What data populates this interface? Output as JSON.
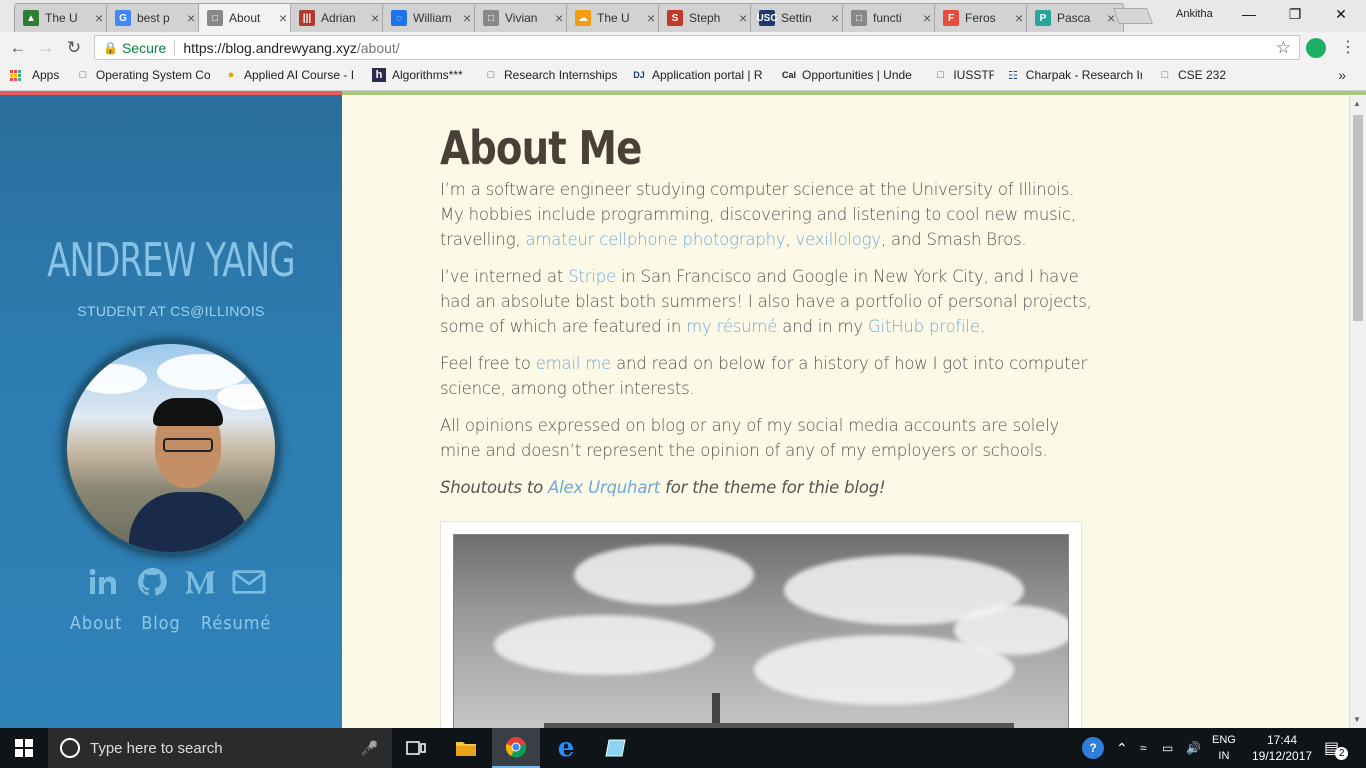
{
  "browser": {
    "tabs": [
      {
        "title": "The U",
        "fav_color": "#2e7d32",
        "fav_char": "▲"
      },
      {
        "title": "best p",
        "fav_color": "#4285f4",
        "fav_char": "G"
      },
      {
        "title": "About",
        "fav_color": "#888888",
        "fav_char": "□",
        "active": true
      },
      {
        "title": "Adrian",
        "fav_color": "#b03a2e",
        "fav_char": "|||"
      },
      {
        "title": "William",
        "fav_color": "#1a73e8",
        "fav_char": "◌"
      },
      {
        "title": "Vivian",
        "fav_color": "#888888",
        "fav_char": "□"
      },
      {
        "title": "The U",
        "fav_color": "#f39c12",
        "fav_char": "☁"
      },
      {
        "title": "Steph",
        "fav_color": "#c0392b",
        "fav_char": "S"
      },
      {
        "title": "Settin",
        "fav_color": "#1f3a6e",
        "fav_char": "USC"
      },
      {
        "title": "functi",
        "fav_color": "#888888",
        "fav_char": "□"
      },
      {
        "title": "Feros",
        "fav_color": "#e74c3c",
        "fav_char": "F"
      },
      {
        "title": "Pasca",
        "fav_color": "#26a69a",
        "fav_char": "P"
      }
    ],
    "profile_name": "Ankitha",
    "secure_label": "Secure",
    "url_host": "https://blog.andrewyang.xyz",
    "url_path": "/about/",
    "bookmarks": [
      {
        "label": "Apps",
        "icon": "apps-grid-icon"
      },
      {
        "label": "Operating System Co",
        "icon": "page-icon"
      },
      {
        "label": "Applied AI Course - I",
        "icon": "aicourse-icon"
      },
      {
        "label": "Algorithms***",
        "icon": "h-icon"
      },
      {
        "label": "Research Internships",
        "icon": "page-icon"
      },
      {
        "label": "Application portal | R",
        "icon": "dj-icon"
      },
      {
        "label": "Opportunities | Unde",
        "icon": "cal-icon"
      },
      {
        "label": "IUSSTF",
        "icon": "page-icon"
      },
      {
        "label": "Charpak - Research Ir",
        "icon": "charpak-icon"
      },
      {
        "label": "CSE 232",
        "icon": "page-icon"
      }
    ]
  },
  "sidebar": {
    "name": "ANDREW YANG",
    "subtitle": "STUDENT AT CS@ILLINOIS",
    "socials": [
      "linkedin-icon",
      "github-icon",
      "medium-icon",
      "email-icon"
    ],
    "nav": [
      "About",
      "Blog",
      "Résumé"
    ]
  },
  "article": {
    "title": "About Me",
    "p1": {
      "t1": "I’m a software engineer studying computer science at the University of Illinois. My hobbies include programming, discovering and listening to cool new music, travelling, ",
      "l1": "amateur cellphone photography",
      "t2": ", ",
      "l2": "vexillology",
      "t3": ", and Smash Bros."
    },
    "p2": {
      "t1": "I’ve interned at ",
      "l1": "Stripe",
      "t2": " in San Francisco and Google in New York City, and I have had an absolute blast both summers! I also have a portfolio of personal projects, some of which are featured in ",
      "l2": "my résumé",
      "t3": " and in my ",
      "l3": "GitHub profile",
      "t4": "."
    },
    "p3": {
      "t1": "Feel free to ",
      "l1": "email me",
      "t2": " and read on below for a history of how I got into computer science, among other interests."
    },
    "p4": "All opinions expressed on blog or any of my social media accounts are solely mine and doesn’t represent the opinion of any of my employers or schools.",
    "p5": {
      "t1": "Shoutouts to ",
      "l1": "Alex Urquhart",
      "t2": " for the theme for thie blog!"
    }
  },
  "taskbar": {
    "search_placeholder": "Type here to search",
    "lang_top": "ENG",
    "lang_bottom": "IN",
    "time": "17:44",
    "date": "19/12/2017",
    "notification_count": "2"
  }
}
